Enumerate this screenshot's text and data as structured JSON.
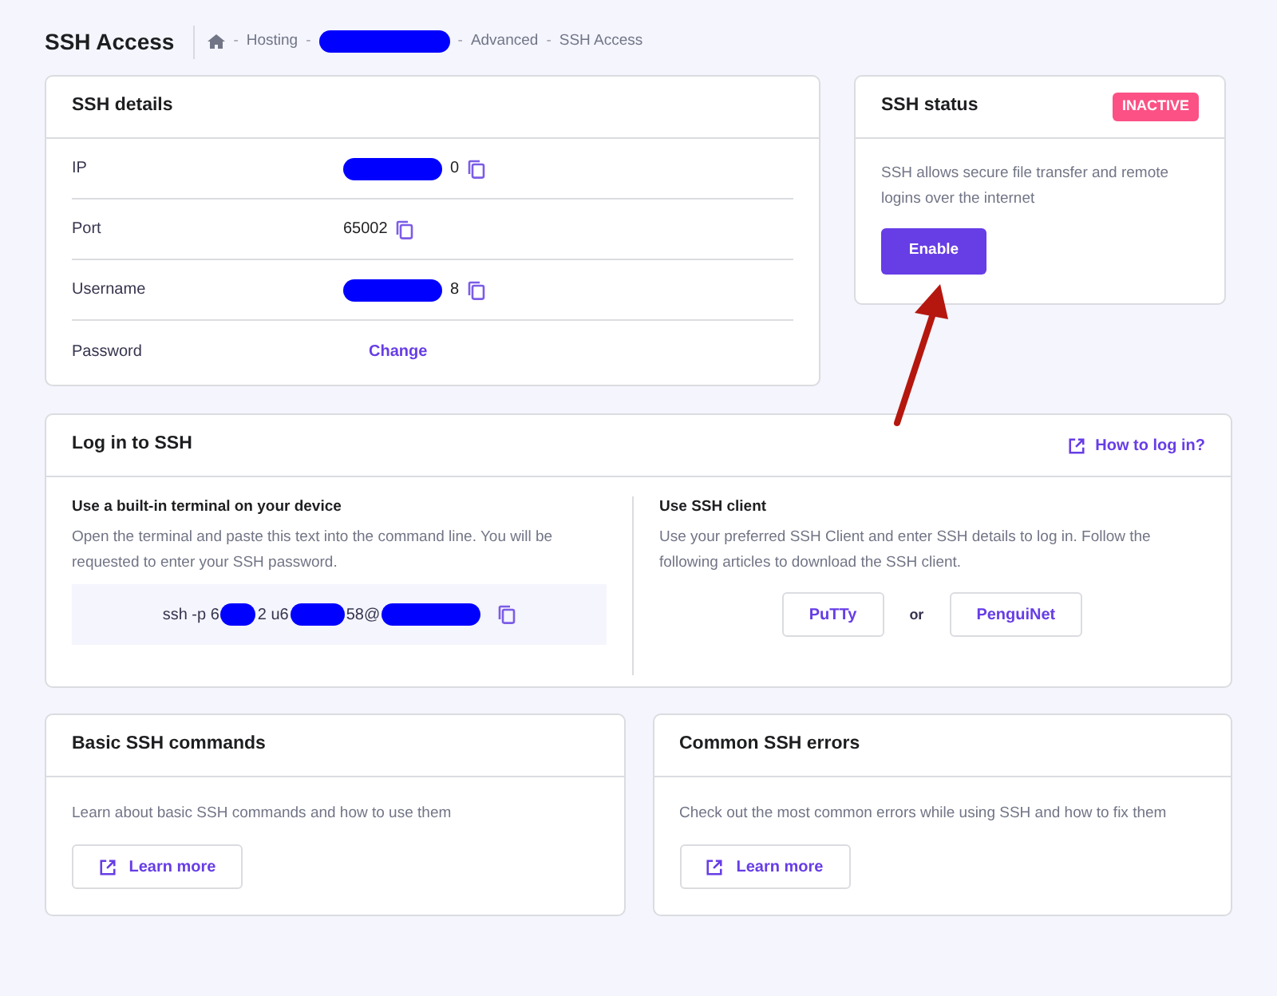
{
  "page_title": "SSH Access",
  "breadcrumb_separator": "-",
  "breadcrumb": [
    {
      "kind": "home"
    },
    {
      "kind": "text",
      "label": "Hosting"
    },
    {
      "kind": "redacted"
    },
    {
      "kind": "text",
      "label": "Advanced"
    },
    {
      "kind": "text",
      "label": "SSH Access"
    }
  ],
  "details": {
    "title": "SSH details",
    "rows": [
      {
        "label": "IP",
        "kind": "copy",
        "parts": [
          {
            "kind": "redacted"
          },
          {
            "kind": "text",
            "text": "0"
          }
        ]
      },
      {
        "label": "Port",
        "kind": "copy",
        "parts": [
          {
            "kind": "text",
            "text": "65002"
          }
        ]
      },
      {
        "label": "Username",
        "kind": "copy",
        "parts": [
          {
            "kind": "redacted"
          },
          {
            "kind": "text",
            "text": "8"
          }
        ]
      },
      {
        "label": "Password",
        "kind": "link",
        "link": "Change"
      }
    ]
  },
  "status": {
    "title": "SSH status",
    "badge": "INACTIVE",
    "active": false,
    "description": "SSH allows secure file transfer and remote logins over the internet",
    "button": "Enable"
  },
  "login": {
    "title": "Log in to SSH",
    "help_link": "How to log in?",
    "terminal": {
      "heading": "Use a built-in terminal on your device",
      "text": "Open the terminal and paste this text into the command line. You will be requested to enter your SSH password.",
      "command": [
        {
          "kind": "text",
          "text": "ssh -p 6"
        },
        {
          "kind": "redacted"
        },
        {
          "kind": "text",
          "text": "2 u6"
        },
        {
          "kind": "redacted"
        },
        {
          "kind": "text",
          "text": "58@"
        },
        {
          "kind": "redacted"
        }
      ]
    },
    "client": {
      "heading": "Use SSH client",
      "text": "Use your preferred SSH Client and enter SSH details to log in. Follow the following articles to download the SSH client.",
      "buttons": [
        "PuTTy",
        "PenguiNet"
      ],
      "separator": "or"
    }
  },
  "cards": [
    {
      "title": "Basic SSH commands",
      "text": "Learn about basic SSH commands and how to use them",
      "button": "Learn more"
    },
    {
      "title": "Common SSH errors",
      "text": "Check out the most common errors while using SSH and how to fix them",
      "button": "Learn more"
    }
  ]
}
